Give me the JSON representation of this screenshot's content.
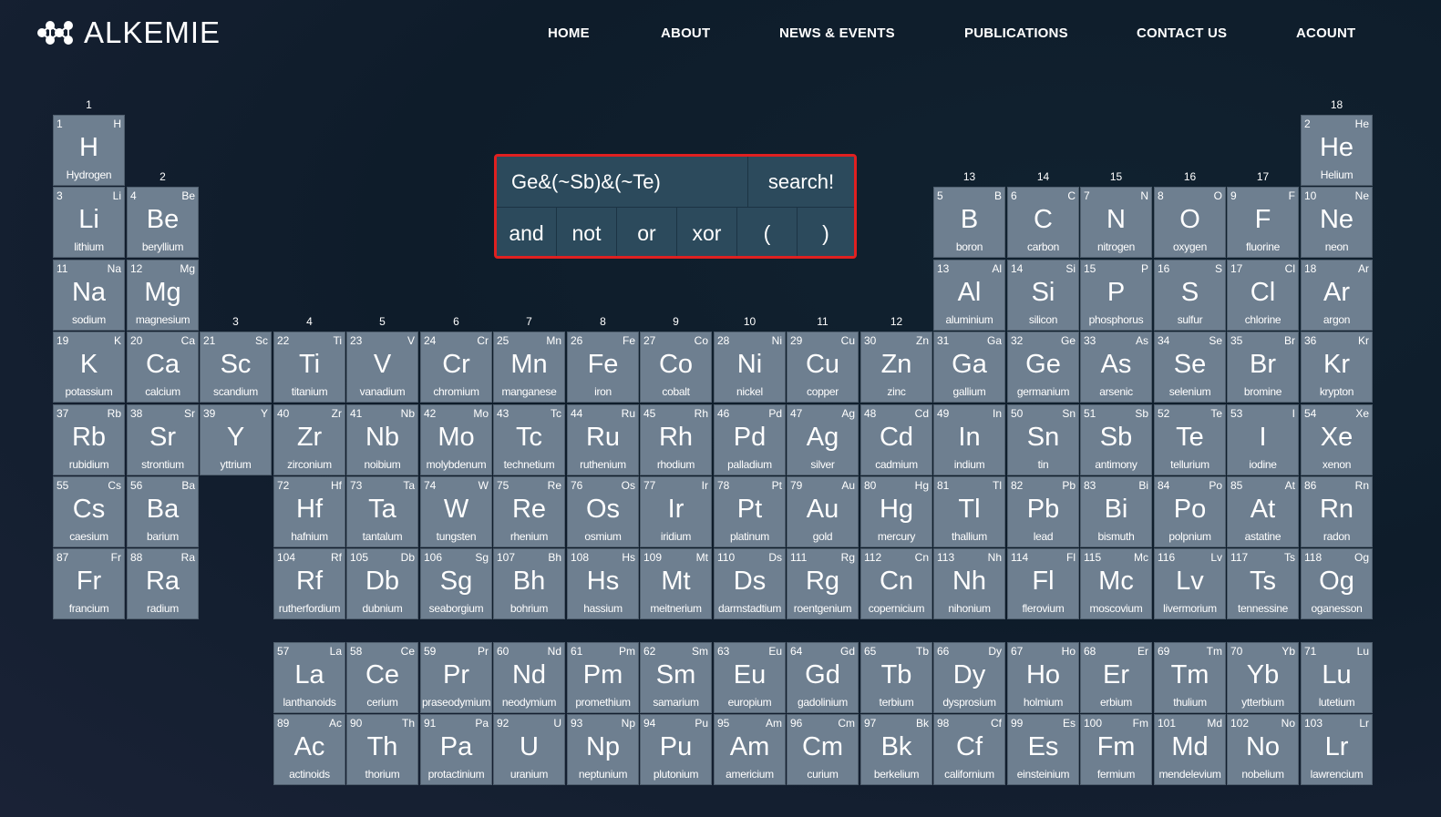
{
  "brand": {
    "name": "ALKEMIE"
  },
  "nav": [
    {
      "label": "HOME",
      "key": "home"
    },
    {
      "label": "ABOUT",
      "key": "about"
    },
    {
      "label": "NEWS & EVENTS",
      "key": "news-events"
    },
    {
      "label": "PUBLICATIONS",
      "key": "publications"
    },
    {
      "label": "CONTACT US",
      "key": "contact-us"
    },
    {
      "label": "ACOUNT",
      "key": "acount"
    }
  ],
  "search": {
    "query": "Ge&(~Sb)&(~Te)",
    "button": "search!",
    "operators": [
      "and",
      "not",
      "or",
      "xor",
      "(",
      ")"
    ]
  },
  "colors": {
    "cell": "#6e7f90",
    "search_bg": "#2c4a5c",
    "highlight": "#e02020"
  },
  "groups": [
    "1",
    "2",
    "3",
    "4",
    "5",
    "6",
    "7",
    "8",
    "9",
    "10",
    "11",
    "12",
    "13",
    "14",
    "15",
    "16",
    "17",
    "18"
  ],
  "elements": [
    {
      "n": 1,
      "s": "H",
      "name": "Hydrogen",
      "p": 1,
      "g": 1
    },
    {
      "n": 2,
      "s": "He",
      "name": "Helium",
      "p": 1,
      "g": 18
    },
    {
      "n": 3,
      "s": "Li",
      "name": "lithium",
      "p": 2,
      "g": 1
    },
    {
      "n": 4,
      "s": "Be",
      "name": "beryllium",
      "p": 2,
      "g": 2
    },
    {
      "n": 5,
      "s": "B",
      "name": "boron",
      "p": 2,
      "g": 13
    },
    {
      "n": 6,
      "s": "C",
      "name": "carbon",
      "p": 2,
      "g": 14
    },
    {
      "n": 7,
      "s": "N",
      "name": "nitrogen",
      "p": 2,
      "g": 15
    },
    {
      "n": 8,
      "s": "O",
      "name": "oxygen",
      "p": 2,
      "g": 16
    },
    {
      "n": 9,
      "s": "F",
      "name": "fluorine",
      "p": 2,
      "g": 17
    },
    {
      "n": 10,
      "s": "Ne",
      "name": "neon",
      "p": 2,
      "g": 18
    },
    {
      "n": 11,
      "s": "Na",
      "name": "sodium",
      "p": 3,
      "g": 1
    },
    {
      "n": 12,
      "s": "Mg",
      "name": "magnesium",
      "p": 3,
      "g": 2
    },
    {
      "n": 13,
      "s": "Al",
      "name": "aluminium",
      "p": 3,
      "g": 13
    },
    {
      "n": 14,
      "s": "Si",
      "name": "silicon",
      "p": 3,
      "g": 14
    },
    {
      "n": 15,
      "s": "P",
      "name": "phosphorus",
      "p": 3,
      "g": 15
    },
    {
      "n": 16,
      "s": "S",
      "name": "sulfur",
      "p": 3,
      "g": 16
    },
    {
      "n": 17,
      "s": "Cl",
      "name": "chlorine",
      "p": 3,
      "g": 17
    },
    {
      "n": 18,
      "s": "Ar",
      "name": "argon",
      "p": 3,
      "g": 18
    },
    {
      "n": 19,
      "s": "K",
      "name": "potassium",
      "p": 4,
      "g": 1
    },
    {
      "n": 20,
      "s": "Ca",
      "name": "calcium",
      "p": 4,
      "g": 2
    },
    {
      "n": 21,
      "s": "Sc",
      "name": "scandium",
      "p": 4,
      "g": 3
    },
    {
      "n": 22,
      "s": "Ti",
      "name": "titanium",
      "p": 4,
      "g": 4
    },
    {
      "n": 23,
      "s": "V",
      "name": "vanadium",
      "p": 4,
      "g": 5
    },
    {
      "n": 24,
      "s": "Cr",
      "name": "chromium",
      "p": 4,
      "g": 6
    },
    {
      "n": 25,
      "s": "Mn",
      "name": "manganese",
      "p": 4,
      "g": 7
    },
    {
      "n": 26,
      "s": "Fe",
      "name": "iron",
      "p": 4,
      "g": 8
    },
    {
      "n": 27,
      "s": "Co",
      "name": "cobalt",
      "p": 4,
      "g": 9
    },
    {
      "n": 28,
      "s": "Ni",
      "name": "nickel",
      "p": 4,
      "g": 10
    },
    {
      "n": 29,
      "s": "Cu",
      "name": "copper",
      "p": 4,
      "g": 11
    },
    {
      "n": 30,
      "s": "Zn",
      "name": "zinc",
      "p": 4,
      "g": 12
    },
    {
      "n": 31,
      "s": "Ga",
      "name": "gallium",
      "p": 4,
      "g": 13
    },
    {
      "n": 32,
      "s": "Ge",
      "name": "germanium",
      "p": 4,
      "g": 14
    },
    {
      "n": 33,
      "s": "As",
      "name": "arsenic",
      "p": 4,
      "g": 15
    },
    {
      "n": 34,
      "s": "Se",
      "name": "selenium",
      "p": 4,
      "g": 16
    },
    {
      "n": 35,
      "s": "Br",
      "name": "bromine",
      "p": 4,
      "g": 17
    },
    {
      "n": 36,
      "s": "Kr",
      "name": "krypton",
      "p": 4,
      "g": 18
    },
    {
      "n": 37,
      "s": "Rb",
      "name": "rubidium",
      "p": 5,
      "g": 1
    },
    {
      "n": 38,
      "s": "Sr",
      "name": "strontium",
      "p": 5,
      "g": 2
    },
    {
      "n": 39,
      "s": "Y",
      "name": "yttrium",
      "p": 5,
      "g": 3
    },
    {
      "n": 40,
      "s": "Zr",
      "name": "zirconium",
      "p": 5,
      "g": 4
    },
    {
      "n": 41,
      "s": "Nb",
      "name": "noibium",
      "p": 5,
      "g": 5
    },
    {
      "n": 42,
      "s": "Mo",
      "name": "molybdenum",
      "p": 5,
      "g": 6
    },
    {
      "n": 43,
      "s": "Tc",
      "name": "technetium",
      "p": 5,
      "g": 7
    },
    {
      "n": 44,
      "s": "Ru",
      "name": "ruthenium",
      "p": 5,
      "g": 8
    },
    {
      "n": 45,
      "s": "Rh",
      "name": "rhodium",
      "p": 5,
      "g": 9
    },
    {
      "n": 46,
      "s": "Pd",
      "name": "palladium",
      "p": 5,
      "g": 10
    },
    {
      "n": 47,
      "s": "Ag",
      "name": "silver",
      "p": 5,
      "g": 11
    },
    {
      "n": 48,
      "s": "Cd",
      "name": "cadmium",
      "p": 5,
      "g": 12
    },
    {
      "n": 49,
      "s": "In",
      "name": "indium",
      "p": 5,
      "g": 13
    },
    {
      "n": 50,
      "s": "Sn",
      "name": "tin",
      "p": 5,
      "g": 14
    },
    {
      "n": 51,
      "s": "Sb",
      "name": "antimony",
      "p": 5,
      "g": 15
    },
    {
      "n": 52,
      "s": "Te",
      "name": "tellurium",
      "p": 5,
      "g": 16
    },
    {
      "n": 53,
      "s": "I",
      "name": "iodine",
      "p": 5,
      "g": 17
    },
    {
      "n": 54,
      "s": "Xe",
      "name": "xenon",
      "p": 5,
      "g": 18
    },
    {
      "n": 55,
      "s": "Cs",
      "name": "caesium",
      "p": 6,
      "g": 1
    },
    {
      "n": 56,
      "s": "Ba",
      "name": "barium",
      "p": 6,
      "g": 2
    },
    {
      "n": 72,
      "s": "Hf",
      "name": "hafnium",
      "p": 6,
      "g": 4
    },
    {
      "n": 73,
      "s": "Ta",
      "name": "tantalum",
      "p": 6,
      "g": 5
    },
    {
      "n": 74,
      "s": "W",
      "name": "tungsten",
      "p": 6,
      "g": 6
    },
    {
      "n": 75,
      "s": "Re",
      "name": "rhenium",
      "p": 6,
      "g": 7
    },
    {
      "n": 76,
      "s": "Os",
      "name": "osmium",
      "p": 6,
      "g": 8
    },
    {
      "n": 77,
      "s": "Ir",
      "name": "iridium",
      "p": 6,
      "g": 9
    },
    {
      "n": 78,
      "s": "Pt",
      "name": "platinum",
      "p": 6,
      "g": 10
    },
    {
      "n": 79,
      "s": "Au",
      "name": "gold",
      "p": 6,
      "g": 11
    },
    {
      "n": 80,
      "s": "Hg",
      "name": "mercury",
      "p": 6,
      "g": 12
    },
    {
      "n": 81,
      "s": "Tl",
      "name": "thallium",
      "p": 6,
      "g": 13
    },
    {
      "n": 82,
      "s": "Pb",
      "name": "lead",
      "p": 6,
      "g": 14
    },
    {
      "n": 83,
      "s": "Bi",
      "name": "bismuth",
      "p": 6,
      "g": 15
    },
    {
      "n": 84,
      "s": "Po",
      "name": "polpnium",
      "p": 6,
      "g": 16
    },
    {
      "n": 85,
      "s": "At",
      "name": "astatine",
      "p": 6,
      "g": 17
    },
    {
      "n": 86,
      "s": "Rn",
      "name": "radon",
      "p": 6,
      "g": 18
    },
    {
      "n": 87,
      "s": "Fr",
      "name": "francium",
      "p": 7,
      "g": 1
    },
    {
      "n": 88,
      "s": "Ra",
      "name": "radium",
      "p": 7,
      "g": 2
    },
    {
      "n": 104,
      "s": "Rf",
      "name": "rutherfordium",
      "p": 7,
      "g": 4
    },
    {
      "n": 105,
      "s": "Db",
      "name": "dubnium",
      "p": 7,
      "g": 5
    },
    {
      "n": 106,
      "s": "Sg",
      "name": "seaborgium",
      "p": 7,
      "g": 6
    },
    {
      "n": 107,
      "s": "Bh",
      "name": "bohrium",
      "p": 7,
      "g": 7
    },
    {
      "n": 108,
      "s": "Hs",
      "name": "hassium",
      "p": 7,
      "g": 8
    },
    {
      "n": 109,
      "s": "Mt",
      "name": "meitnerium",
      "p": 7,
      "g": 9
    },
    {
      "n": 110,
      "s": "Ds",
      "name": "darmstadtium",
      "p": 7,
      "g": 10
    },
    {
      "n": 111,
      "s": "Rg",
      "name": "roentgenium",
      "p": 7,
      "g": 11
    },
    {
      "n": 112,
      "s": "Cn",
      "name": "copernicium",
      "p": 7,
      "g": 12
    },
    {
      "n": 113,
      "s": "Nh",
      "name": "nihonium",
      "p": 7,
      "g": 13
    },
    {
      "n": 114,
      "s": "Fl",
      "name": "flerovium",
      "p": 7,
      "g": 14
    },
    {
      "n": 115,
      "s": "Mc",
      "name": "moscovium",
      "p": 7,
      "g": 15
    },
    {
      "n": 116,
      "s": "Lv",
      "name": "livermorium",
      "p": 7,
      "g": 16
    },
    {
      "n": 117,
      "s": "Ts",
      "name": "tennessine",
      "p": 7,
      "g": 17
    },
    {
      "n": 118,
      "s": "Og",
      "name": "oganesson",
      "p": 7,
      "g": 18
    },
    {
      "n": 57,
      "s": "La",
      "name": "lanthanoids",
      "p": 8,
      "g": 4
    },
    {
      "n": 58,
      "s": "Ce",
      "name": "cerium",
      "p": 8,
      "g": 5
    },
    {
      "n": 59,
      "s": "Pr",
      "name": "praseodymium",
      "p": 8,
      "g": 6
    },
    {
      "n": 60,
      "s": "Nd",
      "name": "neodymium",
      "p": 8,
      "g": 7
    },
    {
      "n": 61,
      "s": "Pm",
      "name": "promethium",
      "p": 8,
      "g": 8
    },
    {
      "n": 62,
      "s": "Sm",
      "name": "samarium",
      "p": 8,
      "g": 9
    },
    {
      "n": 63,
      "s": "Eu",
      "name": "europium",
      "p": 8,
      "g": 10
    },
    {
      "n": 64,
      "s": "Gd",
      "name": "gadolinium",
      "p": 8,
      "g": 11
    },
    {
      "n": 65,
      "s": "Tb",
      "name": "terbium",
      "p": 8,
      "g": 12
    },
    {
      "n": 66,
      "s": "Dy",
      "name": "dysprosium",
      "p": 8,
      "g": 13
    },
    {
      "n": 67,
      "s": "Ho",
      "name": "holmium",
      "p": 8,
      "g": 14
    },
    {
      "n": 68,
      "s": "Er",
      "name": "erbium",
      "p": 8,
      "g": 15
    },
    {
      "n": 69,
      "s": "Tm",
      "name": "thulium",
      "p": 8,
      "g": 16
    },
    {
      "n": 70,
      "s": "Yb",
      "name": "ytterbium",
      "p": 8,
      "g": 17
    },
    {
      "n": 71,
      "s": "Lu",
      "name": "lutetium",
      "p": 8,
      "g": 18
    },
    {
      "n": 89,
      "s": "Ac",
      "name": "actinoids",
      "p": 9,
      "g": 4
    },
    {
      "n": 90,
      "s": "Th",
      "name": "thorium",
      "p": 9,
      "g": 5
    },
    {
      "n": 91,
      "s": "Pa",
      "name": "protactinium",
      "p": 9,
      "g": 6
    },
    {
      "n": 92,
      "s": "U",
      "name": "uranium",
      "p": 9,
      "g": 7
    },
    {
      "n": 93,
      "s": "Np",
      "name": "neptunium",
      "p": 9,
      "g": 8
    },
    {
      "n": 94,
      "s": "Pu",
      "name": "plutonium",
      "p": 9,
      "g": 9
    },
    {
      "n": 95,
      "s": "Am",
      "name": "americium",
      "p": 9,
      "g": 10
    },
    {
      "n": 96,
      "s": "Cm",
      "name": "curium",
      "p": 9,
      "g": 11
    },
    {
      "n": 97,
      "s": "Bk",
      "name": "berkelium",
      "p": 9,
      "g": 12
    },
    {
      "n": 98,
      "s": "Cf",
      "name": "californium",
      "p": 9,
      "g": 13
    },
    {
      "n": 99,
      "s": "Es",
      "name": "einsteinium",
      "p": 9,
      "g": 14
    },
    {
      "n": 100,
      "s": "Fm",
      "name": "fermium",
      "p": 9,
      "g": 15
    },
    {
      "n": 101,
      "s": "Md",
      "name": "mendelevium",
      "p": 9,
      "g": 16
    },
    {
      "n": 102,
      "s": "No",
      "name": "nobelium",
      "p": 9,
      "g": 17
    },
    {
      "n": 103,
      "s": "Lr",
      "name": "lawrencium",
      "p": 9,
      "g": 18
    }
  ]
}
